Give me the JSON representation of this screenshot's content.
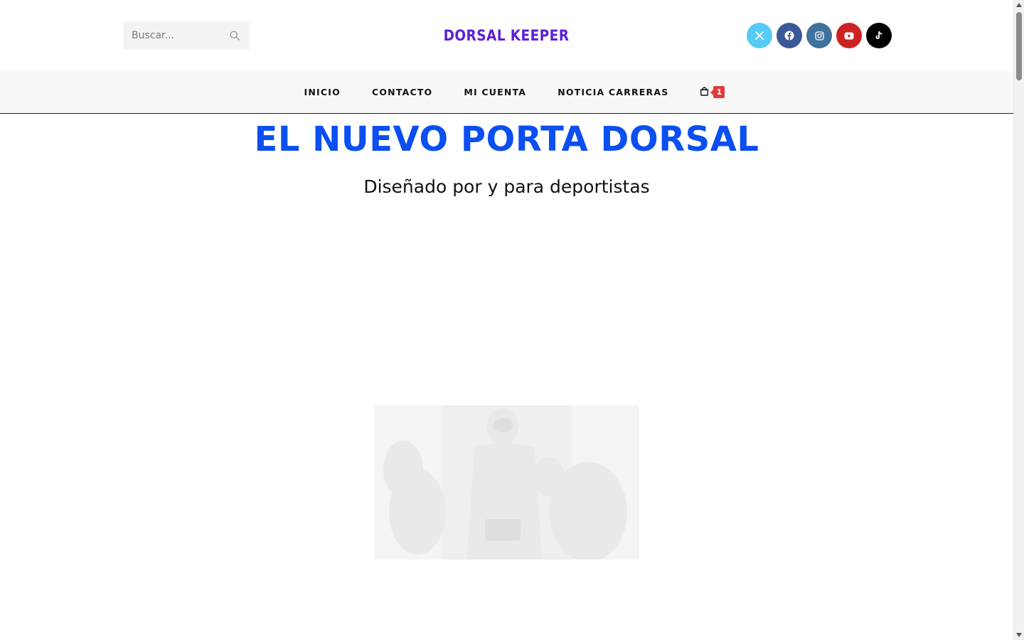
{
  "header": {
    "search": {
      "placeholder": "Buscar..."
    },
    "logo": "DORSAL KEEPER",
    "socials": [
      {
        "name": "x-twitter",
        "color": "#55ccf4"
      },
      {
        "name": "facebook",
        "color": "#3b5998"
      },
      {
        "name": "instagram",
        "color": "#3f729b"
      },
      {
        "name": "youtube",
        "color": "#cc2222"
      },
      {
        "name": "tiktok",
        "color": "#000000"
      }
    ]
  },
  "nav": {
    "items": [
      {
        "label": "INICIO"
      },
      {
        "label": "CONTACTO"
      },
      {
        "label": "MI CUENTA"
      },
      {
        "label": "NOTICIA CARRERAS"
      }
    ],
    "cart": {
      "icon": "shopping-bag-icon",
      "count": "1"
    }
  },
  "hero": {
    "title": "EL NUEVO PORTA DORSAL",
    "subtitle": "Diseñado por y para deportistas"
  },
  "colors": {
    "accent": "#0b4ff0",
    "logo": "#5b1fd6",
    "badge": "#e33b3b"
  }
}
